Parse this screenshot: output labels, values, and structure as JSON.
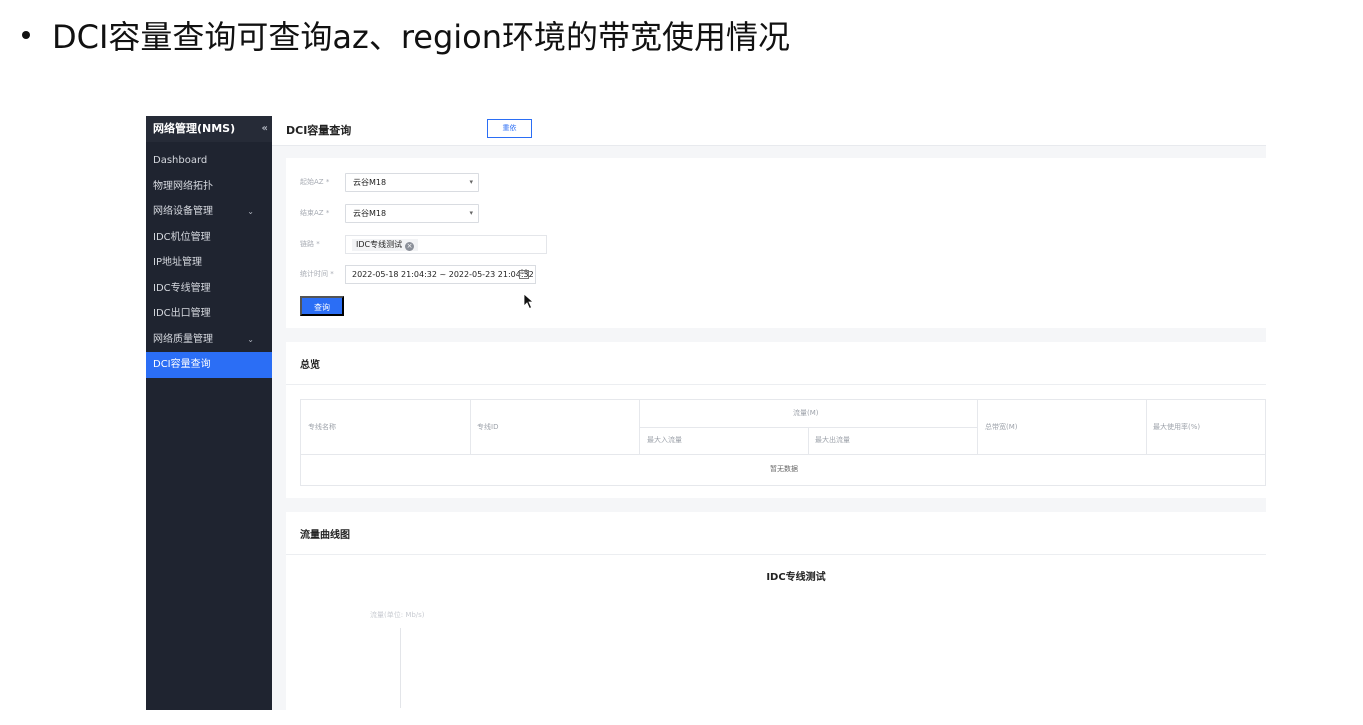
{
  "slide": {
    "title": "DCI容量查询可查询az、region环境的带宽使用情况"
  },
  "sidebar": {
    "brand": "网络管理(NMS)",
    "collapse_glyph": "«",
    "items": [
      {
        "label": "Dashboard"
      },
      {
        "label": "物理网络拓扑"
      },
      {
        "label": "网络设备管理"
      },
      {
        "label": "IDC机位管理"
      },
      {
        "label": "IP地址管理"
      },
      {
        "label": "IDC专线管理"
      },
      {
        "label": "IDC出口管理"
      },
      {
        "label": "网络质量管理"
      },
      {
        "label": "DCI容量查询"
      }
    ]
  },
  "topbar": {
    "title": "DCI容量查询",
    "reset_label": "重依"
  },
  "form": {
    "start_az": {
      "label": "起始AZ",
      "value": "云谷M18"
    },
    "end_az": {
      "label": "结束AZ",
      "value": "云谷M18"
    },
    "link": {
      "label": "链路",
      "tag": "IDC专线测试"
    },
    "time": {
      "label": "统计时间",
      "value": "2022-05-18 21:04:32 ~ 2022-05-23 21:04:32"
    },
    "query_label": "查询"
  },
  "overview": {
    "title": "总览",
    "columns": {
      "name": "专线名称",
      "id": "专线ID",
      "traffic": "流量(M)",
      "in": "最大入流量",
      "out": "最大出流量",
      "total": "总带宽(M)",
      "max_usage": "最大使用率(%)"
    },
    "empty_text": "暂无数据"
  },
  "chart": {
    "section_title": "流量曲线图",
    "title": "IDC专线测试",
    "y_unit": "流量(单位: Mb/s)"
  },
  "colors": {
    "sidebar_bg": "#1f2430",
    "accent": "#2b6ef5"
  }
}
